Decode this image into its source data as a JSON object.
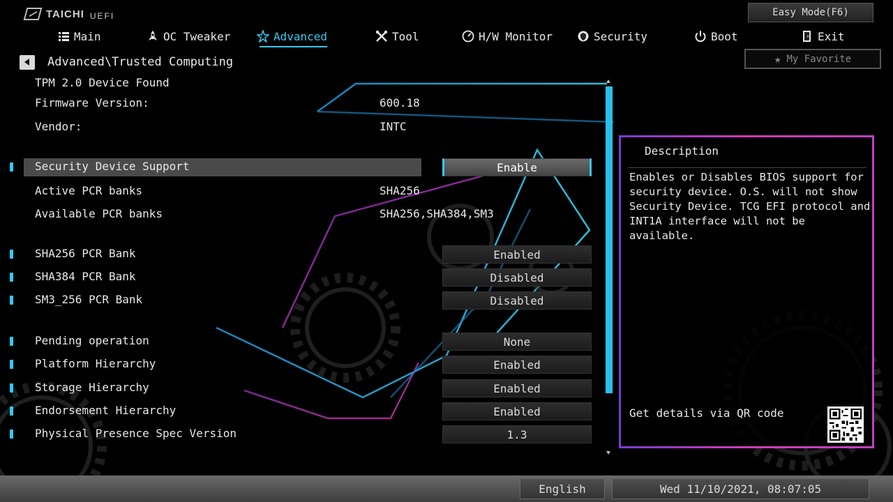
{
  "brand": {
    "name": "TAICHI",
    "sub": "UEFI",
    "icon": "taichi-logo-icon"
  },
  "top_right": {
    "easy_mode": "Easy Mode(F6)",
    "my_favorite": "My Favorite",
    "favorite_icon": "star-icon"
  },
  "nav": {
    "tabs": [
      {
        "label": "Main",
        "icon": "list-icon",
        "active": false
      },
      {
        "label": "OC Tweaker",
        "icon": "rocket-icon",
        "active": false
      },
      {
        "label": "Advanced",
        "icon": "star-gear-icon",
        "active": true
      },
      {
        "label": "Tool",
        "icon": "wrench-icon",
        "active": false
      },
      {
        "label": "H/W Monitor",
        "icon": "monitor-gauge-icon",
        "active": false
      },
      {
        "label": "Security",
        "icon": "shield-icon",
        "active": false
      },
      {
        "label": "Boot",
        "icon": "power-icon",
        "active": false
      },
      {
        "label": "Exit",
        "icon": "exit-door-icon",
        "active": false
      }
    ]
  },
  "breadcrumb": "Advanced\\Trusted Computing",
  "info": {
    "tpm_found": "TPM 2.0 Device Found",
    "firmware_label": "Firmware Version:",
    "firmware_value": "600.18",
    "vendor_label": "Vendor:",
    "vendor_value": "INTC"
  },
  "settings": {
    "security_device_support": {
      "label": "Security Device Support",
      "value": "Enable"
    },
    "active_pcr_banks": {
      "label": "Active PCR banks",
      "value": "SHA256"
    },
    "available_pcr_banks": {
      "label": "Available PCR banks",
      "value": "SHA256,SHA384,SM3"
    },
    "sha256_pcr_bank": {
      "label": "SHA256 PCR Bank",
      "value": "Enabled"
    },
    "sha384_pcr_bank": {
      "label": "SHA384 PCR Bank",
      "value": "Disabled"
    },
    "sm3_256_pcr_bank": {
      "label": "SM3_256 PCR Bank",
      "value": "Disabled"
    },
    "pending_operation": {
      "label": "Pending operation",
      "value": "None"
    },
    "platform_hierarchy": {
      "label": "Platform Hierarchy",
      "value": "Enabled"
    },
    "storage_hierarchy": {
      "label": "Storage Hierarchy",
      "value": "Enabled"
    },
    "endorsement_hierarchy": {
      "label": "Endorsement Hierarchy",
      "value": "Enabled"
    },
    "physical_presence_spec": {
      "label": "Physical Presence Spec Version",
      "value": "1.3"
    }
  },
  "description": {
    "title": "Description",
    "text": "Enables or Disables BIOS support for\nsecurity device. O.S. will not show\nSecurity Device. TCG EFI protocol and\nINT1A interface will not be available.",
    "qr_label": "Get details via QR code"
  },
  "footer": {
    "language": "English",
    "datetime": "Wed 11/10/2021, 08:07:05"
  },
  "colors": {
    "accent": "#35c8ef",
    "panel_border": "#d23ab8",
    "footer": "#555555"
  }
}
